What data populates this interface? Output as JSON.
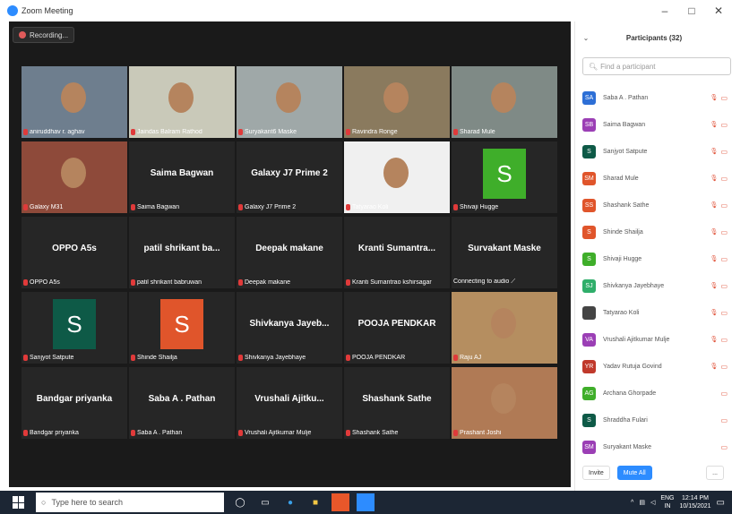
{
  "window": {
    "title": "Zoom Meeting",
    "controls": [
      "–",
      "□",
      "✕"
    ]
  },
  "recording": {
    "label": "Recording..."
  },
  "tiles": [
    {
      "label": "aniruddhav r. aghav",
      "type": "video",
      "active": true
    },
    {
      "label": "Jaindas Balram Rathod",
      "type": "video"
    },
    {
      "label": "Suryakant6 Maske",
      "type": "video"
    },
    {
      "label": "Ravindra Ronge",
      "type": "video"
    },
    {
      "label": "Sharad Mule",
      "type": "video"
    },
    {
      "label": "Galaxy M31",
      "type": "video"
    },
    {
      "label": "Saima Bagwan",
      "name": "Saima Bagwan",
      "type": "name"
    },
    {
      "label": "Galaxy J7 Prime 2",
      "name": "Galaxy J7 Prime 2",
      "type": "name"
    },
    {
      "label": "Tatyarao Koli",
      "type": "video"
    },
    {
      "label": "Shivaji Hugge",
      "type": "avatar",
      "letter": "S",
      "color": "#3fae2a"
    },
    {
      "label": "OPPO A5s",
      "name": "OPPO A5s",
      "type": "name"
    },
    {
      "label": "patil shrikant babruwan",
      "name": "patil shrikant ba...",
      "type": "name"
    },
    {
      "label": "Deepak makane",
      "name": "Deepak makane",
      "type": "name"
    },
    {
      "label": "Kranti Sumantrao kshirsagar",
      "name": "Kranti Sumantra...",
      "type": "name"
    },
    {
      "label": "Connecting to audio",
      "name": "Survakant Maske",
      "type": "name",
      "connecting": true
    },
    {
      "label": "Sanjyot Satpute",
      "type": "avatar",
      "letter": "S",
      "color": "#0e5a47"
    },
    {
      "label": "Shinde Shailja",
      "type": "avatar",
      "letter": "S",
      "color": "#e0552b"
    },
    {
      "label": "Shivkanya Jayebhaye",
      "name": "Shivkanya Jayeb...",
      "type": "name"
    },
    {
      "label": "POOJA PENDKAR",
      "name": "POOJA PENDKAR",
      "type": "name"
    },
    {
      "label": "Raju AJ",
      "type": "video"
    },
    {
      "label": "Bandgar priyanka",
      "name": "Bandgar priyanka",
      "type": "name"
    },
    {
      "label": "Saba A . Pathan",
      "name": "Saba A . Pathan",
      "type": "name"
    },
    {
      "label": "Vrushali Ajitkumar Mulje",
      "name": "Vrushali Ajitku...",
      "type": "name"
    },
    {
      "label": "Shashank Sathe",
      "name": "Shashank Sathe",
      "type": "name"
    },
    {
      "label": "Prashant Joshi",
      "type": "video"
    }
  ],
  "panel": {
    "title": "Participants (32)",
    "search_placeholder": "Find a participant",
    "participants": [
      {
        "initials": "SA",
        "name": "Saba A . Pathan",
        "color": "#2d6fd6",
        "cam": true
      },
      {
        "initials": "SB",
        "name": "Saima Bagwan",
        "color": "#9b3fb5",
        "cam": true
      },
      {
        "initials": "S",
        "name": "Sanjyot Satpute",
        "color": "#0e5a47",
        "cam": true
      },
      {
        "initials": "SM",
        "name": "Sharad Mule",
        "color": "#e0552b",
        "cam": true
      },
      {
        "initials": "SS",
        "name": "Shashank Sathe",
        "color": "#e0552b",
        "cam": true
      },
      {
        "initials": "S",
        "name": "Shinde Shailja",
        "color": "#e0552b",
        "cam": true
      },
      {
        "initials": "S",
        "name": "Shivaji Hugge",
        "color": "#3fae2a",
        "cam": true
      },
      {
        "initials": "SJ",
        "name": "Shivkanya Jayebhaye",
        "color": "#2fae6a",
        "cam": true
      },
      {
        "initials": "",
        "name": "Tatyarao Koli",
        "color": "#444444",
        "cam": true
      },
      {
        "initials": "VA",
        "name": "Vrushali Ajitkumar Mulje",
        "color": "#9b3fb5",
        "cam": true
      },
      {
        "initials": "YR",
        "name": "Yadav Rutuja Govind",
        "color": "#c0392b",
        "cam": true
      },
      {
        "initials": "AG",
        "name": "Archana Ghorpade",
        "color": "#3fae2a",
        "cam": false
      },
      {
        "initials": "S",
        "name": "Shraddha Fulari",
        "color": "#0e5a47",
        "cam": false
      },
      {
        "initials": "SM",
        "name": "Suryakant Maske",
        "color": "#9b3fb5",
        "cam": false
      }
    ],
    "invite": "Invite",
    "mute_all": "Mute All",
    "more": "..."
  },
  "taskbar": {
    "search_placeholder": "Type here to search",
    "lang": "ENG",
    "region": "IN",
    "time": "12:14 PM",
    "date": "10/15/2021"
  }
}
